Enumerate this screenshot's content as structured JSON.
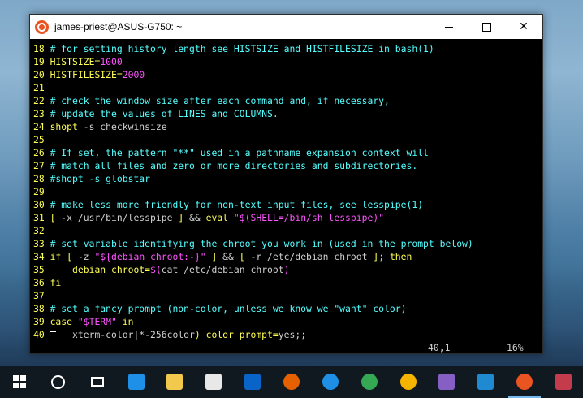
{
  "window": {
    "title": "james-priest@ASUS-G750: ~",
    "controls": {
      "minimize": "",
      "maximize": "",
      "close": "✕"
    }
  },
  "terminal": {
    "lines": [
      {
        "num": "18",
        "segments": [
          {
            "cls": "c",
            "text": "# for setting history length see HISTSIZE and HISTFILESIZE in bash(1)"
          }
        ]
      },
      {
        "num": "19",
        "segments": [
          {
            "cls": "k",
            "text": "HISTSIZE="
          },
          {
            "cls": "m",
            "text": "1000"
          }
        ]
      },
      {
        "num": "20",
        "segments": [
          {
            "cls": "k",
            "text": "HISTFILESIZE="
          },
          {
            "cls": "m",
            "text": "2000"
          }
        ]
      },
      {
        "num": "21",
        "segments": []
      },
      {
        "num": "22",
        "segments": [
          {
            "cls": "c",
            "text": "# check the window size after each command and, if necessary,"
          }
        ]
      },
      {
        "num": "23",
        "segments": [
          {
            "cls": "c",
            "text": "# update the values of LINES and COLUMNS."
          }
        ]
      },
      {
        "num": "24",
        "segments": [
          {
            "cls": "k",
            "text": "shopt"
          },
          {
            "cls": "t",
            "text": " -s checkwinsize"
          }
        ]
      },
      {
        "num": "25",
        "segments": []
      },
      {
        "num": "26",
        "segments": [
          {
            "cls": "c",
            "text": "# If set, the pattern \"**\" used in a pathname expansion context will"
          }
        ]
      },
      {
        "num": "27",
        "segments": [
          {
            "cls": "c",
            "text": "# match all files and zero or more directories and subdirectories."
          }
        ]
      },
      {
        "num": "28",
        "segments": [
          {
            "cls": "c",
            "text": "#shopt -s globstar"
          }
        ]
      },
      {
        "num": "29",
        "segments": []
      },
      {
        "num": "30",
        "segments": [
          {
            "cls": "c",
            "text": "# make less more friendly for non-text input files, see lesspipe(1)"
          }
        ]
      },
      {
        "num": "31",
        "segments": [
          {
            "cls": "k",
            "text": "["
          },
          {
            "cls": "t",
            "text": " -x /usr/bin/lesspipe "
          },
          {
            "cls": "k",
            "text": "]"
          },
          {
            "cls": "t",
            "text": " && "
          },
          {
            "cls": "k",
            "text": "eval"
          },
          {
            "cls": "t",
            "text": " "
          },
          {
            "cls": "s",
            "text": "\"$(SHELL=/bin/sh lesspipe)\""
          }
        ]
      },
      {
        "num": "32",
        "segments": []
      },
      {
        "num": "33",
        "segments": [
          {
            "cls": "c",
            "text": "# set variable identifying the chroot you work in (used in the prompt below)"
          }
        ]
      },
      {
        "num": "34",
        "segments": [
          {
            "cls": "k",
            "text": "if"
          },
          {
            "cls": "t",
            "text": " "
          },
          {
            "cls": "k",
            "text": "["
          },
          {
            "cls": "t",
            "text": " -z "
          },
          {
            "cls": "s",
            "text": "\"${debian_chroot:-}\""
          },
          {
            "cls": "t",
            "text": " "
          },
          {
            "cls": "k",
            "text": "]"
          },
          {
            "cls": "t",
            "text": " && "
          },
          {
            "cls": "k",
            "text": "["
          },
          {
            "cls": "t",
            "text": " -r /etc/debian_chroot "
          },
          {
            "cls": "k",
            "text": "]"
          },
          {
            "cls": "t",
            "text": "; "
          },
          {
            "cls": "k",
            "text": "then"
          }
        ]
      },
      {
        "num": "35",
        "segments": [
          {
            "cls": "t",
            "text": "    "
          },
          {
            "cls": "k",
            "text": "debian_chroot="
          },
          {
            "cls": "m",
            "text": "$("
          },
          {
            "cls": "t",
            "text": "cat /etc/debian_chroot"
          },
          {
            "cls": "m",
            "text": ")"
          }
        ]
      },
      {
        "num": "36",
        "segments": [
          {
            "cls": "k",
            "text": "fi"
          }
        ]
      },
      {
        "num": "37",
        "segments": []
      },
      {
        "num": "38",
        "segments": [
          {
            "cls": "c",
            "text": "# set a fancy prompt (non-color, unless we know we \"want\" color)"
          }
        ]
      },
      {
        "num": "39",
        "segments": [
          {
            "cls": "k",
            "text": "case"
          },
          {
            "cls": "t",
            "text": " "
          },
          {
            "cls": "s",
            "text": "\"$TERM\""
          },
          {
            "cls": "t",
            "text": " "
          },
          {
            "cls": "k",
            "text": "in"
          }
        ]
      },
      {
        "num": "40",
        "segments": [
          {
            "cls": "t",
            "text": "    xterm-color|*-256color"
          },
          {
            "cls": "k",
            "text": ")"
          },
          {
            "cls": "t",
            "text": " "
          },
          {
            "cls": "k",
            "text": "color_prompt="
          },
          {
            "cls": "t",
            "text": "yes;;"
          }
        ]
      }
    ],
    "status": {
      "position": "40,1",
      "percent": "16%"
    }
  },
  "taskbar": {
    "items": [
      {
        "name": "start-button",
        "icon": "windows-logo"
      },
      {
        "name": "cortana-button",
        "icon": "cortana-circle"
      },
      {
        "name": "task-view-button",
        "icon": "task-view"
      },
      {
        "name": "edge-button",
        "icon": "edge",
        "color": "#1e90e8"
      },
      {
        "name": "file-explorer-button",
        "icon": "folder",
        "color": "#f2c94c"
      },
      {
        "name": "store-button",
        "icon": "store",
        "color": "#e8e8e8"
      },
      {
        "name": "outlook-button",
        "icon": "outlook",
        "color": "#0a64c8"
      },
      {
        "name": "firefox-button",
        "icon": "firefox",
        "color": "#e66000"
      },
      {
        "name": "firefox-dev-button",
        "icon": "firefox-dev",
        "color": "#1f8fe6"
      },
      {
        "name": "chrome-button",
        "icon": "chrome",
        "color": "#34a853"
      },
      {
        "name": "chrome-canary-button",
        "icon": "chrome-canary",
        "color": "#f4b400"
      },
      {
        "name": "visual-studio-button",
        "icon": "visual-studio",
        "color": "#865fc5"
      },
      {
        "name": "vscode-button",
        "icon": "vscode",
        "color": "#1f8ad2"
      },
      {
        "name": "ubuntu-button",
        "icon": "ubuntu",
        "color": "#e95420",
        "active": true
      },
      {
        "name": "extra-app-button",
        "icon": "app",
        "color": "#c43c4c"
      }
    ]
  },
  "colors": {
    "comment": "#54ffff",
    "keyword": "#ffff54",
    "string": "#ff54ff",
    "accent": "#e95420"
  }
}
